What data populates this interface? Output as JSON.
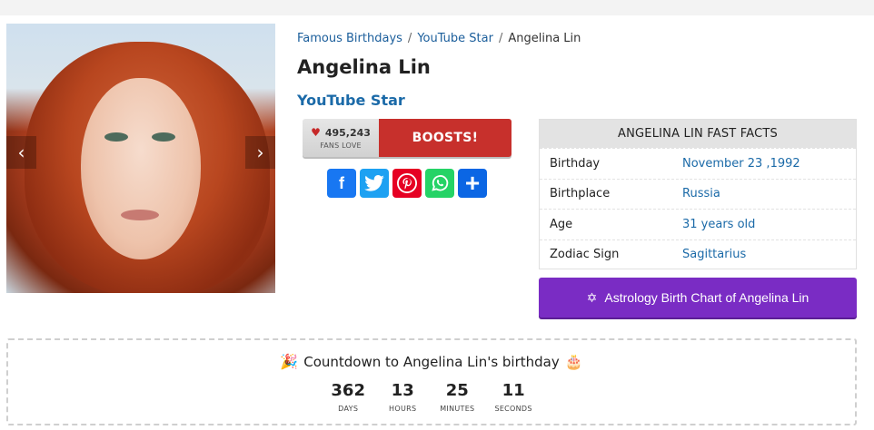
{
  "breadcrumb": {
    "items": [
      "Famous Birthdays",
      "YouTube Star"
    ],
    "separator": "/",
    "current": "Angelina Lin"
  },
  "profile": {
    "name": "Angelina Lin",
    "profession": "YouTube Star"
  },
  "carousel": {
    "prev_icon": "‹",
    "next_icon": "›"
  },
  "boost": {
    "fans_count": "495,243",
    "fans_label": "FANS LOVE",
    "button_label": "BOOSTS!",
    "heart_color": "#c62828",
    "button_color": "#c7302c"
  },
  "share": {
    "buttons": [
      {
        "name": "facebook",
        "glyph": "f",
        "color": "#1877f2"
      },
      {
        "name": "twitter",
        "glyph": "t",
        "color": "#1da1f2"
      },
      {
        "name": "pinterest",
        "glyph": "P",
        "color": "#e60023"
      },
      {
        "name": "whatsapp",
        "glyph": "W",
        "color": "#25d366"
      },
      {
        "name": "share",
        "glyph": "+",
        "color": "#0b66e4"
      }
    ]
  },
  "facts": {
    "title": "ANGELINA LIN FAST FACTS",
    "rows": [
      {
        "label": "Birthday",
        "value": "November 23 ,1992"
      },
      {
        "label": "Birthplace",
        "value": "Russia"
      },
      {
        "label": "Age",
        "value": "31 years old"
      },
      {
        "label": "Zodiac Sign",
        "value": "Sagittarius"
      }
    ]
  },
  "astrology": {
    "icon": "✡",
    "label": "Astrology Birth Chart of Angelina Lin",
    "color": "#7a2cc4"
  },
  "countdown": {
    "title": "Countdown to Angelina Lin's birthday",
    "left_emoji": "🎉",
    "right_emoji": "🎂",
    "units": [
      {
        "value": "362",
        "label": "DAYS"
      },
      {
        "value": "13",
        "label": "HOURS"
      },
      {
        "value": "25",
        "label": "MINUTES"
      },
      {
        "value": "11",
        "label": "SECONDS"
      }
    ]
  }
}
